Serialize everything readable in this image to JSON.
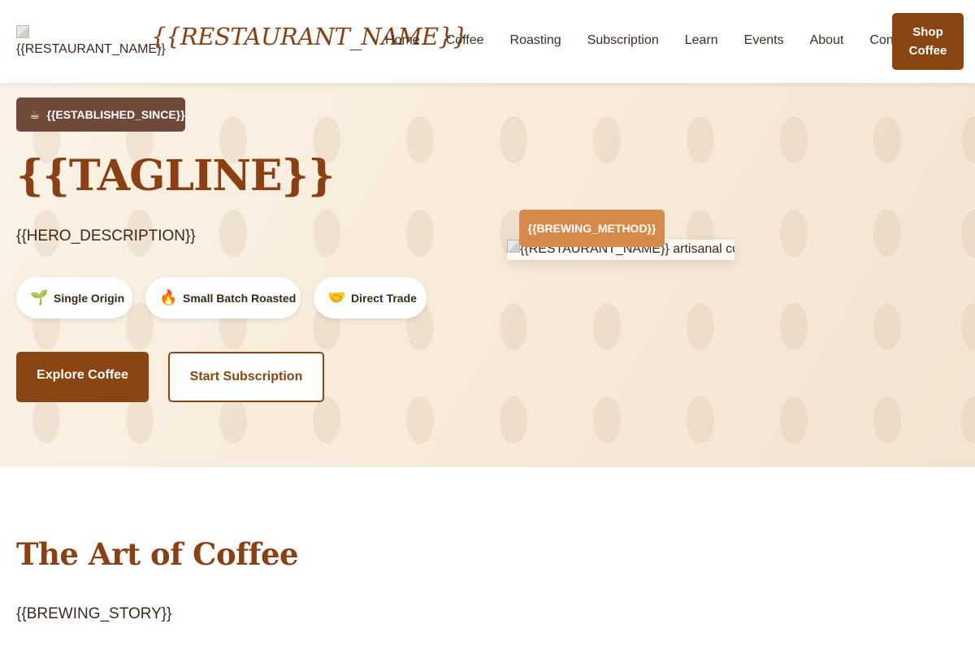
{
  "header": {
    "logo_alt": "{{RESTAURANT_NAME}}",
    "brand": "{{RESTAURANT_NAME}}",
    "nav": [
      "Home",
      "Coffee",
      "Roasting",
      "Subscription",
      "Learn",
      "Events",
      "About",
      "Contact"
    ],
    "shop_line1": "Shop",
    "shop_line2": "Coffee"
  },
  "hero": {
    "established": "{{ESTABLISHED_SINCE}}",
    "established_icon": "coffee-cup-icon",
    "tagline": "{{TAGLINE}}",
    "description": "{{HERO_DESCRIPTION}}",
    "features": [
      {
        "label": "Single Origin",
        "icon": "seedling-icon"
      },
      {
        "label": "Small Batch Roasted",
        "icon": "fire-icon"
      },
      {
        "label": "Direct Trade",
        "icon": "handshake-icon"
      }
    ],
    "primary_cta": "Explore Coffee",
    "secondary_cta": "Start Subscription",
    "image_alt": "{{RESTAURANT_NAME}} artisanal coffee",
    "brewing_badge": "{{BREWING_METHOD}}"
  },
  "story": {
    "title": "The Art of Coffee",
    "text": "{{BREWING_STORY}}"
  },
  "colors": {
    "brand": "#8b4513",
    "heading": "#8b3f12",
    "badge_dark": "#6f4a38",
    "badge_accent": "#d68a4a"
  }
}
